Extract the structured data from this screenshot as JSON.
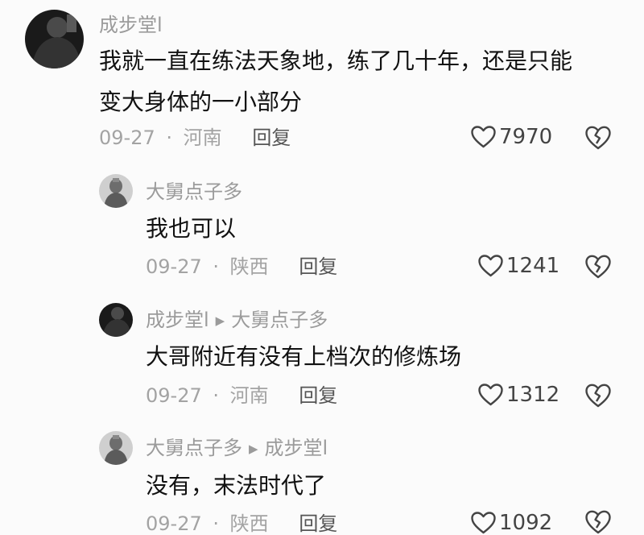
{
  "comments": [
    {
      "author": "成步堂l",
      "reply_to": "",
      "text_line1": "我就一直在练法天象地，练了几十年，还是只能",
      "text_line2": "变大身体的一小部分",
      "date": "09-27",
      "location": "河南",
      "reply_label": "回复",
      "likes": "7970",
      "avatar_icon": "dark-person-avatar"
    },
    {
      "author": "大舅点子多",
      "reply_to": "",
      "text_line1": "我也可以",
      "date": "09-27",
      "location": "陕西",
      "reply_label": "回复",
      "likes": "1241",
      "avatar_icon": "statue-avatar"
    },
    {
      "author": "成步堂l",
      "reply_to": "大舅点子多",
      "text_line1": "大哥附近有没有上档次的修炼场",
      "date": "09-27",
      "location": "河南",
      "reply_label": "回复",
      "likes": "1312",
      "avatar_icon": "dark-person-avatar"
    },
    {
      "author": "大舅点子多",
      "reply_to": "成步堂l",
      "text_line1": "没有，末法时代了",
      "date": "09-27",
      "location": "陕西",
      "reply_label": "回复",
      "likes": "1092",
      "avatar_icon": "statue-avatar"
    }
  ],
  "meta_separator": "·",
  "reply_arrow": "▶",
  "icons": {
    "like": "heart-outline-icon",
    "dislike": "broken-heart-icon"
  },
  "colors": {
    "background": "#fbfbfb",
    "author": "#9b9b9b",
    "meta": "#a3a3a3",
    "text": "#111111"
  }
}
